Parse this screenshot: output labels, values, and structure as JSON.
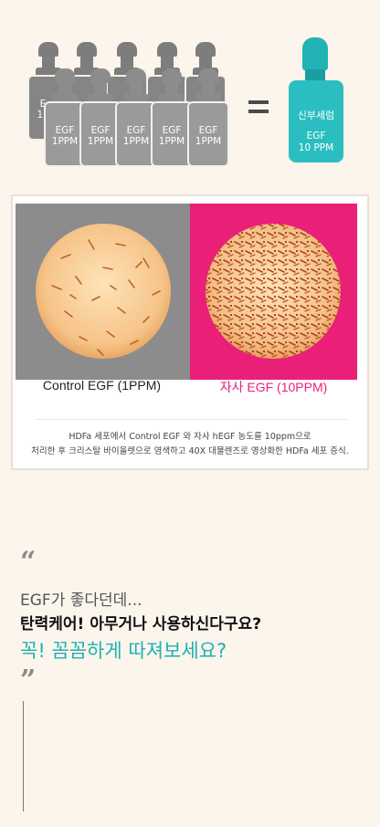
{
  "gray_bottles": [
    {
      "line1": "EGF",
      "line2": "1PPM"
    },
    {
      "line1": "EGF",
      "line2": "1PPM"
    },
    {
      "line1": "EGF",
      "line2": "1PPM"
    },
    {
      "line1": "EGF",
      "line2": "1PPM"
    },
    {
      "line1": "EGF",
      "line2": "1PPM"
    }
  ],
  "back_bottle_partial": {
    "line1": "E",
    "line2": "1P"
  },
  "teal_bottle": {
    "name": "신부세럼",
    "egf": "EGF",
    "ppm": "10 PPM",
    "color": "#2bbec0"
  },
  "comparison": {
    "left_label": "Control EGF (1PPM)",
    "right_label": "자사 EGF (10PPM)",
    "left_bg": "#8c8c8c",
    "right_bg": "#e91f78",
    "right_label_color": "#e91f78",
    "caption_line1": "HDFa 세포에서 Control EGF 와 자사 hEGF 농도를 10ppm으로",
    "caption_line2": "처리한 후 크리스탈 바이올렛으로 염색하고 40X 대물렌즈로 영상화한 HDFa 세포 증식."
  },
  "quote": {
    "open_mark": "“",
    "line1": "EGF가 좋다던데...",
    "line2": "탄력케어!  아무거나 사용하신다구요?",
    "line3": "꼭!  꼼꼼하게 따져보세요?",
    "close_mark": "”",
    "accent_color": "#1fb0b1"
  }
}
